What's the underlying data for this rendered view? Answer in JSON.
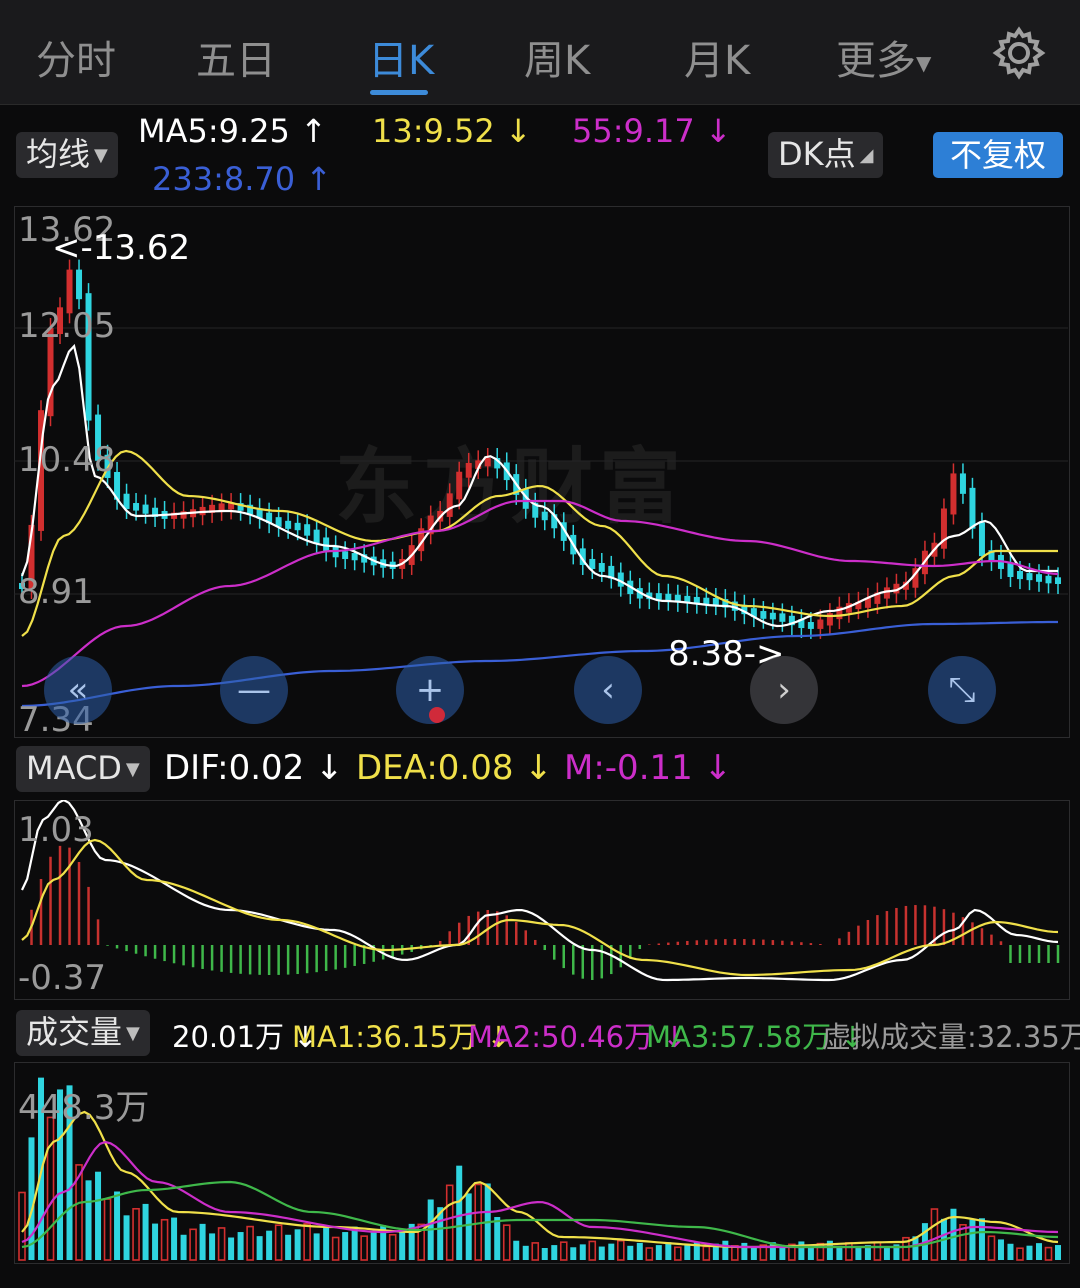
{
  "tabs": [
    {
      "label": "分时"
    },
    {
      "label": "五日"
    },
    {
      "label": "日K"
    },
    {
      "label": "周K"
    },
    {
      "label": "月K"
    },
    {
      "label": "更多"
    }
  ],
  "active_tab": "日K",
  "ma_row": {
    "selector": "均线",
    "ma5": "MA5:9.25 ↑",
    "ma13": "13:9.52 ↓",
    "ma55": "55:9.17 ↓",
    "ma233": "233:8.70 ↑",
    "dk_button": "DK点",
    "fq_button": "不复权"
  },
  "kline": {
    "y_ticks": [
      "13.62",
      "12.05",
      "10.48",
      "8.91",
      "7.34"
    ],
    "high_marker": "<-13.62",
    "low_marker": "8.38->",
    "watermark": "东方财富"
  },
  "macd": {
    "selector": "MACD",
    "dif": "DIF:0.02 ↓",
    "dea": "DEA:0.08 ↓",
    "m": "M:-0.11 ↓",
    "y_top": "1.03",
    "y_bottom": "-0.37"
  },
  "volume": {
    "selector": "成交量",
    "value": "20.01万 ↓",
    "ma1": "MA1:36.15万 ↓",
    "ma2": "MA2:50.46万 ↓",
    "ma3": "MA3:57.58万 ↓",
    "virtual": "虚拟成交量:32.35万",
    "y_top": "448.3万"
  },
  "colors": {
    "up": "#d22f2f",
    "down": "#2fd5e0",
    "ma5": "#ffffff",
    "ma13": "#f0e04a",
    "ma55": "#cc2ec9",
    "ma233": "#3a5fd6",
    "accent": "#3d8bd9",
    "macd_pos": "#c8322f",
    "macd_neg": "#3fb84a",
    "vol_ma3": "#3fb84a"
  },
  "icons": [
    "gear-icon",
    "double-left-icon",
    "minus-icon",
    "plus-icon",
    "chevron-left-icon",
    "chevron-right-icon",
    "expand-icon"
  ],
  "chart_data": {
    "type": "candlestick",
    "y_range": [
      7.34,
      13.62
    ],
    "high": 13.62,
    "low": 8.38,
    "series_note_ma5": 9.25,
    "series_note_ma13": 9.52,
    "series_note_ma55": 9.17,
    "series_note_ma233": 8.7
  }
}
